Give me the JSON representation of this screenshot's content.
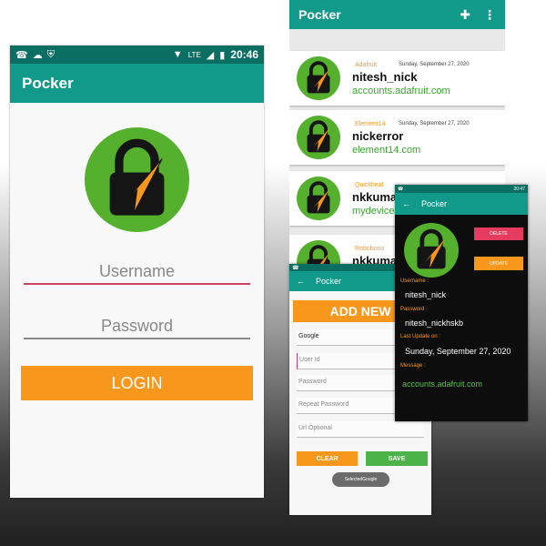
{
  "app": {
    "title": "Pocker"
  },
  "colors": {
    "primary": "#11998a",
    "primary_dark": "#0a6f62",
    "accent_orange": "#f7981d",
    "logo_green": "#55b02e",
    "link_green": "#3aa530",
    "delete_red": "#e53b5f",
    "save_green": "#4cb348"
  },
  "status_bar": {
    "time": "20:46",
    "network": "LTE",
    "small_time": "20:47"
  },
  "login": {
    "username_placeholder": "Username",
    "password_placeholder": "Password",
    "login_label": "LOGIN"
  },
  "list": {
    "items": [
      {
        "company": "Adafruit",
        "date": "Sunday, September 27, 2020",
        "username": "nitesh_nick",
        "url": "accounts.adafruit.com"
      },
      {
        "company": "Element14",
        "date": "Sunday, September 27, 2020",
        "username": "nickerror",
        "url": "element14.com"
      },
      {
        "company": "Quickheal",
        "date": "",
        "username": "nkkuma",
        "url": "mydevice."
      },
      {
        "company": "Robobono",
        "date": "",
        "username": "nkkuma",
        "url": ""
      }
    ]
  },
  "add_new": {
    "title": "Pocker",
    "add_label": "ADD NEW",
    "company_value": "Google",
    "user_id_placeholder": "User Id",
    "password_placeholder": "Password",
    "repeat_password_placeholder": "Repeat Password",
    "url_placeholder": "Url Optional",
    "clear_label": "CLEAR",
    "save_label": "SAVE",
    "toast": "SelectedGoogle"
  },
  "detail": {
    "title": "Pocker",
    "delete_label": "DELETE",
    "update_label": "UPDATE",
    "username_label": "Username :",
    "username_value": "nitesh_nick",
    "password_label": "Password :",
    "password_value": "nitesh_nickhskb",
    "last_update_label": "Last Update on :",
    "last_update_value": "Sunday, September 27, 2020",
    "message_label": "Message :",
    "url": "accounts.adafruit.com"
  },
  "icons": [
    "whatsapp-icon",
    "cloud-icon",
    "shield-icon",
    "wifi-icon",
    "signal-icon",
    "battery-icon",
    "add-user-icon",
    "more-vert-icon",
    "back-arrow-icon",
    "lock-logo-icon"
  ]
}
